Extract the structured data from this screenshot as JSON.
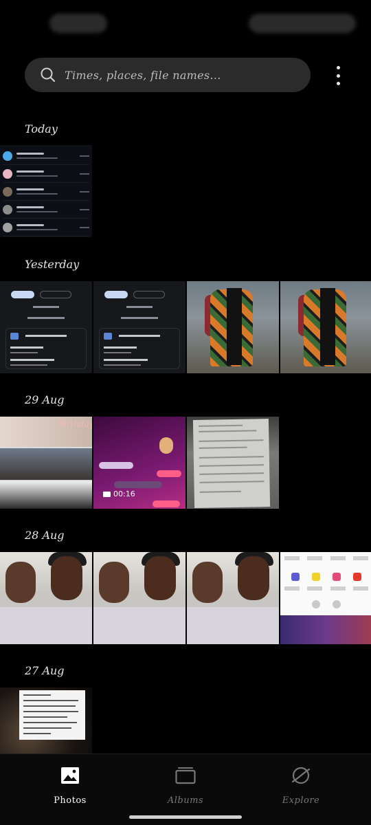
{
  "search": {
    "placeholder": "Times, places, file names..."
  },
  "sections": [
    {
      "date": "Today",
      "count": 1
    },
    {
      "date": "Yesterday",
      "count": 4
    },
    {
      "date": "29 Aug",
      "count": 3
    },
    {
      "date": "28 Aug",
      "count": 4
    },
    {
      "date": "27 Aug",
      "count": 1
    }
  ],
  "media": {
    "video_duration": "00:16",
    "birthday_text": "Birthday"
  },
  "bottom_nav": {
    "items": [
      {
        "label": "Photos",
        "icon": "photos-icon",
        "active": true
      },
      {
        "label": "Albums",
        "icon": "albums-icon",
        "active": false
      },
      {
        "label": "Explore",
        "icon": "explore-icon",
        "active": false
      }
    ]
  },
  "colors": {
    "background": "#000000",
    "search_bg": "#2b2b2b",
    "active_nav": "#ffffff",
    "inactive_nav": "#777777"
  }
}
